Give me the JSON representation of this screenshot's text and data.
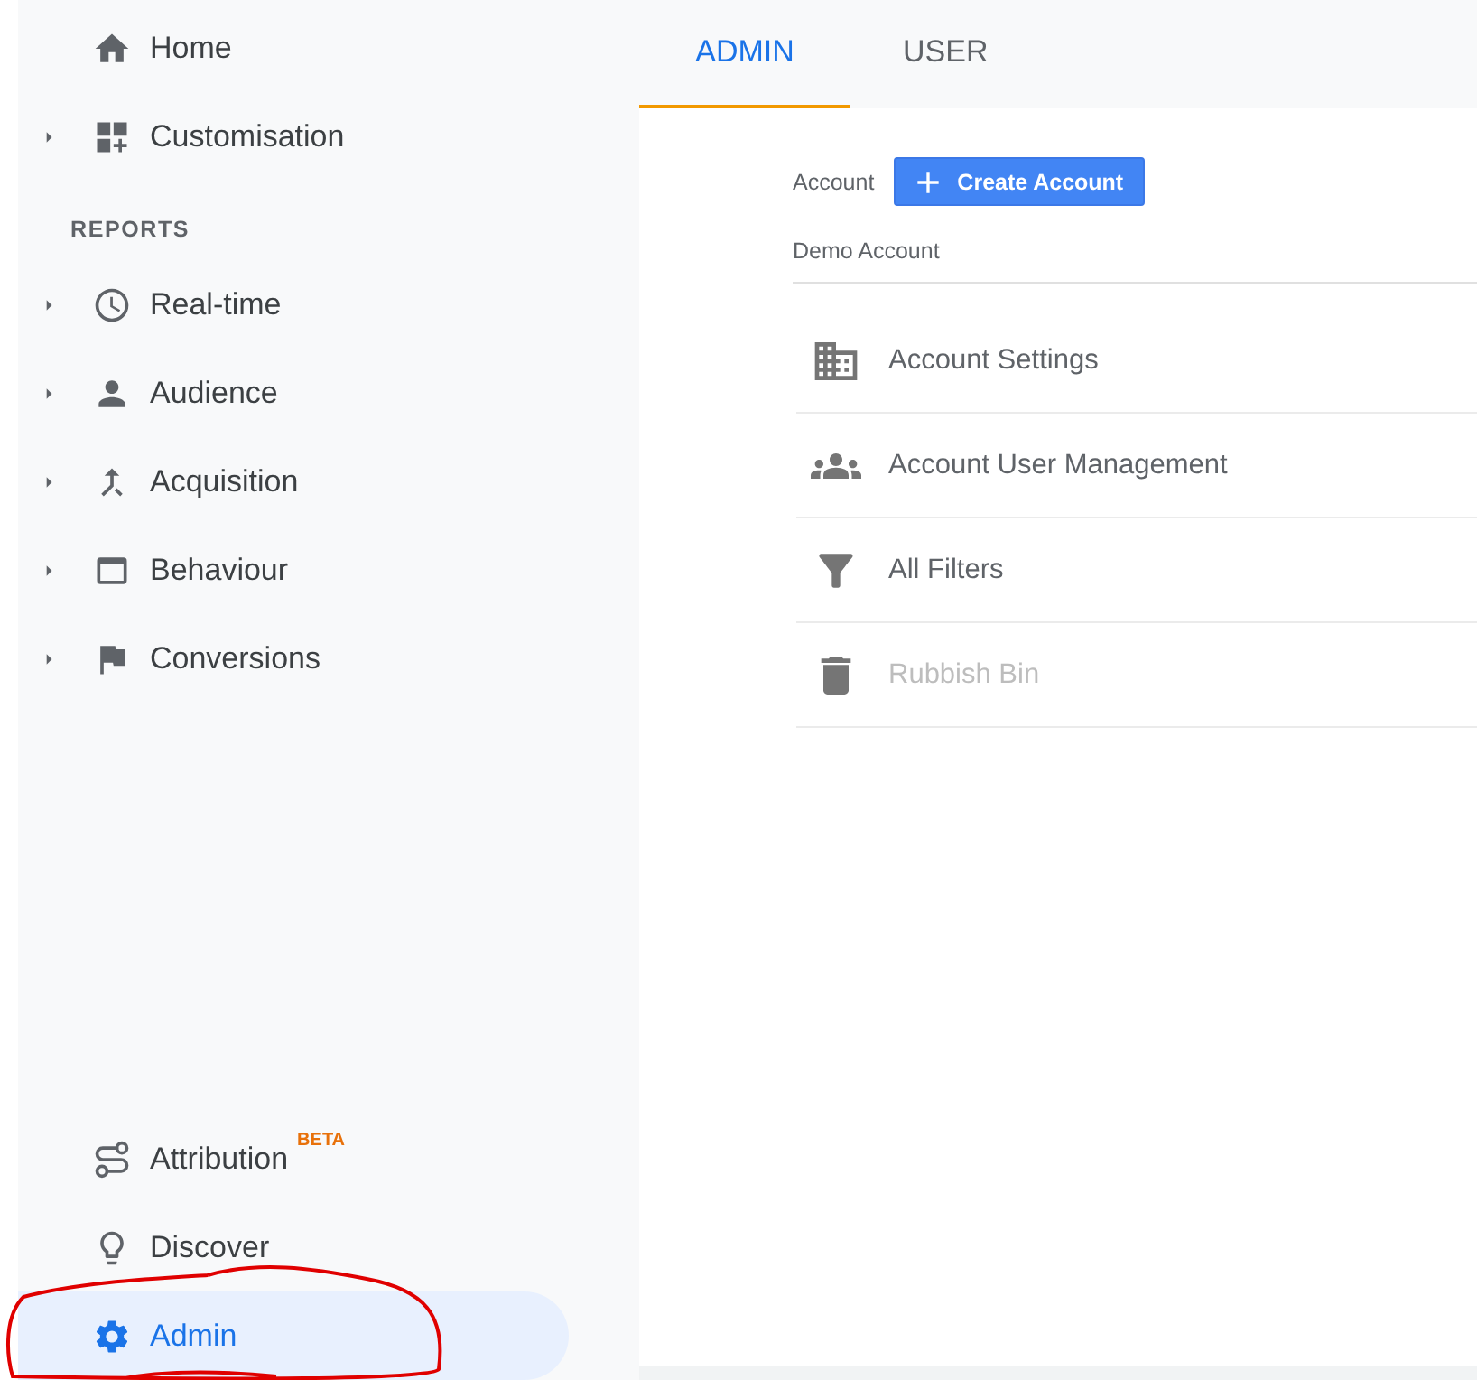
{
  "sidebar": {
    "top_items": [
      {
        "label": "Home",
        "expandable": false,
        "selected": false
      },
      {
        "label": "Customisation",
        "expandable": true,
        "selected": false
      }
    ],
    "section_heading": "REPORTS",
    "report_items": [
      {
        "label": "Real-time",
        "expandable": true,
        "selected": false
      },
      {
        "label": "Audience",
        "expandable": true,
        "selected": false
      },
      {
        "label": "Acquisition",
        "expandable": true,
        "selected": false
      },
      {
        "label": "Behaviour",
        "expandable": true,
        "selected": false
      },
      {
        "label": "Conversions",
        "expandable": true,
        "selected": false
      }
    ],
    "bottom_items": [
      {
        "label": "Attribution",
        "badge": "BETA",
        "expandable": false,
        "selected": false
      },
      {
        "label": "Discover",
        "expandable": false,
        "selected": false
      },
      {
        "label": "Admin",
        "expandable": false,
        "selected": true
      }
    ]
  },
  "tabs": [
    {
      "label": "ADMIN",
      "selected": true
    },
    {
      "label": "USER",
      "selected": false
    }
  ],
  "account": {
    "label": "Account",
    "create_button": "Create Account",
    "name": "Demo Account",
    "items": [
      {
        "label": "Account Settings",
        "disabled": false
      },
      {
        "label": "Account User Management",
        "disabled": false
      },
      {
        "label": "All Filters",
        "disabled": false
      },
      {
        "label": "Rubbish Bin",
        "disabled": true
      }
    ]
  }
}
